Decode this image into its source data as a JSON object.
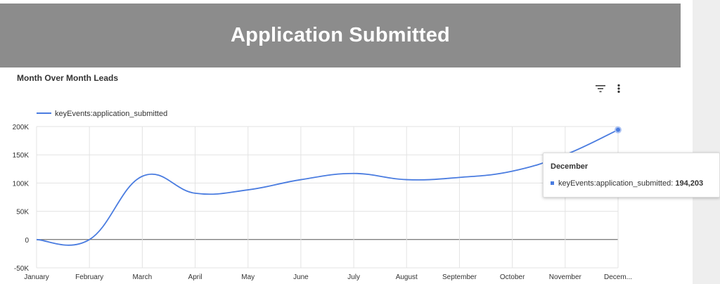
{
  "banner": {
    "title": "Application Submitted"
  },
  "chart_title": "Month Over Month Leads",
  "colors": {
    "banner_bg": "#8c8c8c",
    "series_line": "#4a7ce0",
    "side_panel": "#eeeeee"
  },
  "icons": {
    "filter": "filter-icon",
    "more": "more-vert-icon"
  },
  "tooltip": {
    "title": "December",
    "series_label": "keyEvents:application_submitted:",
    "value": "194,203"
  },
  "chart_data": {
    "type": "line",
    "title": "Month Over Month Leads",
    "xlabel": "",
    "ylabel": "",
    "categories": [
      "January",
      "February",
      "March",
      "April",
      "May",
      "June",
      "July",
      "August",
      "September",
      "October",
      "November",
      "December"
    ],
    "category_tick_labels": [
      "January",
      "February",
      "March",
      "April",
      "May",
      "June",
      "July",
      "August",
      "September",
      "October",
      "November",
      "Decem..."
    ],
    "ylim": [
      -50000,
      200000
    ],
    "y_ticks": [
      -50000,
      0,
      50000,
      100000,
      150000,
      200000
    ],
    "y_tick_labels": [
      "-50K",
      "0",
      "50K",
      "100K",
      "150K",
      "200K"
    ],
    "grid": true,
    "legend": "top-left",
    "series": [
      {
        "name": "keyEvents:application_submitted",
        "values": [
          0,
          0,
          112000,
          82000,
          88000,
          106000,
          117000,
          106000,
          110000,
          121000,
          150000,
          194203
        ]
      }
    ]
  }
}
